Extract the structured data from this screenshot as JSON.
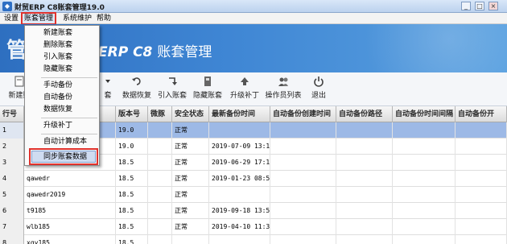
{
  "titlebar": {
    "title": "财贸ERP  C8账套管理19.0",
    "min": "_",
    "max": "□",
    "close": "×"
  },
  "menubar": {
    "items": [
      "设置",
      "账套管理",
      "系统维护",
      "帮助"
    ]
  },
  "banner": {
    "logo": "管",
    "title": "ERP C8",
    "title_cn": "账套管理"
  },
  "toolbar": {
    "items": [
      {
        "label": "新建账",
        "icon": "new-icon"
      },
      {
        "label": "套",
        "icon": "arrow-down-icon"
      },
      {
        "label": "数据恢复",
        "icon": "restore-icon"
      },
      {
        "label": "引入账套",
        "icon": "import-icon"
      },
      {
        "label": "隐藏账套",
        "icon": "hide-icon"
      },
      {
        "label": "升级补丁",
        "icon": "upgrade-icon"
      },
      {
        "label": "操作员列表",
        "icon": "users-icon"
      },
      {
        "label": "退出",
        "icon": "power-icon"
      }
    ]
  },
  "table": {
    "headers": [
      "行号",
      "",
      "版本号",
      "微豚",
      "安全状态",
      "最新备份时间",
      "自动备份创建时间",
      "自动备份路径",
      "自动备份时间间隔",
      "自动备份开"
    ],
    "rows": [
      {
        "n": "1",
        "name": "",
        "ver": "19.0",
        "status": "正常",
        "time": "",
        "selected": true
      },
      {
        "n": "2",
        "name": "",
        "ver": "19.0",
        "status": "正常",
        "time": "2019-07-09 13:13"
      },
      {
        "n": "3",
        "name": "",
        "ver": "18.5",
        "status": "正常",
        "time": "2019-06-29 17:12"
      },
      {
        "n": "4",
        "name": "qawedr",
        "ver": "18.5",
        "status": "正常",
        "time": "2019-01-23 08:55"
      },
      {
        "n": "5",
        "name": "qawedr2019",
        "ver": "18.5",
        "status": "正常",
        "time": ""
      },
      {
        "n": "6",
        "name": "t9185",
        "ver": "18.5",
        "status": "正常",
        "time": "2019-09-18 13:50"
      },
      {
        "n": "7",
        "name": "wlb185",
        "ver": "18.5",
        "status": "正常",
        "time": "2019-04-10 11:36"
      },
      {
        "n": "8",
        "name": "xgy185",
        "ver": "18.5",
        "status": "",
        "time": ""
      }
    ]
  },
  "dropdown": {
    "items": [
      "新建账套",
      "删除账套",
      "引入账套",
      "隐藏账套",
      "手动备份",
      "自动备份",
      "数据恢复",
      "升级补丁",
      "自动计算成本",
      "同步账套数据"
    ]
  }
}
